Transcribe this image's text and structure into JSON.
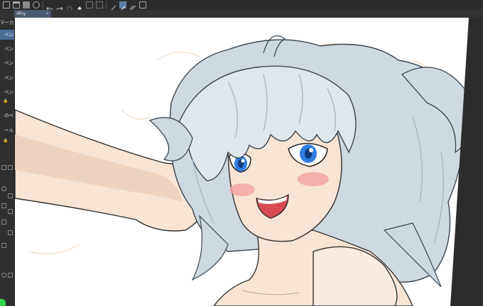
{
  "toolbar": {
    "icons": [
      "new-file-icon",
      "open-file-icon",
      "save-icon",
      "export-icon",
      "undo-icon",
      "redo-icon",
      "clear-icon",
      "fill-icon",
      "transform-icon",
      "selection-icon",
      "ruler-icon",
      "pen-icon",
      "snap-icon",
      "preview-icon"
    ]
  },
  "tab": {
    "title": "4fny",
    "close": "×"
  },
  "left_panel": {
    "items": [
      {
        "label": "マーカー",
        "active": false
      },
      {
        "label": "ペン",
        "active": true
      },
      {
        "label": "ペン",
        "active": false
      },
      {
        "label": "ペン",
        "active": false
      },
      {
        "label": "ペン",
        "active": false
      },
      {
        "label": "ペン",
        "active": false
      },
      {
        "label": "のペ",
        "active": false
      },
      {
        "label": "ール",
        "active": false
      }
    ],
    "lock_glyph": "🔒"
  },
  "colors": {
    "toolbar_bg": "#2b2b2b",
    "panel_bg": "#2f2f2f",
    "active_item": "#4a6f97",
    "canvas_bg": "#ffffff",
    "hair": "#cfd9e0",
    "hair_shadow": "#9fb3c2",
    "skin": "#f7e4d4",
    "skin_shadow": "#e9b9a2",
    "eye": "#2f7de0",
    "blush": "#f2a3a0",
    "mouth": "#d94a52",
    "green_indicator": "#2fd84a"
  }
}
